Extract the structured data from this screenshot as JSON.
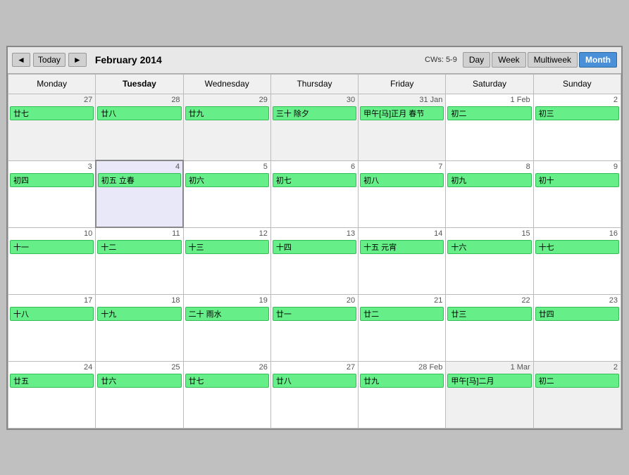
{
  "toolbar": {
    "prev_label": "◄",
    "today_label": "Today",
    "next_label": "►",
    "title": "February 2014",
    "cws_label": "CWs: 5-9",
    "views": [
      "Day",
      "Week",
      "Multiweek",
      "Month"
    ],
    "active_view": "Month"
  },
  "columns": [
    "Monday",
    "Tuesday",
    "Wednesday",
    "Thursday",
    "Friday",
    "Saturday",
    "Sunday"
  ],
  "today_col_index": 1,
  "weeks": [
    {
      "cells": [
        {
          "date": "27",
          "date_label": "27",
          "other_month": true,
          "event": "廿七"
        },
        {
          "date": "28",
          "date_label": "28",
          "other_month": true,
          "event": "廿八"
        },
        {
          "date": "29",
          "date_label": "29",
          "other_month": true,
          "event": "廿九"
        },
        {
          "date": "30",
          "date_label": "30",
          "other_month": true,
          "event": "三十 除夕"
        },
        {
          "date": "31 Jan",
          "date_label": "31 Jan",
          "other_month": true,
          "event": "甲午[马]正月 春节"
        },
        {
          "date": "1 Feb",
          "date_label": "1 Feb",
          "other_month": false,
          "event": "初二"
        },
        {
          "date": "2",
          "date_label": "2",
          "other_month": false,
          "event": "初三"
        }
      ]
    },
    {
      "cells": [
        {
          "date": "3",
          "date_label": "3",
          "other_month": false,
          "event": "初四"
        },
        {
          "date": "4",
          "date_label": "4",
          "other_month": false,
          "today": true,
          "event": "初五 立春"
        },
        {
          "date": "5",
          "date_label": "5",
          "other_month": false,
          "event": "初六"
        },
        {
          "date": "6",
          "date_label": "6",
          "other_month": false,
          "event": "初七"
        },
        {
          "date": "7",
          "date_label": "7",
          "other_month": false,
          "event": "初八"
        },
        {
          "date": "8",
          "date_label": "8",
          "other_month": false,
          "event": "初九"
        },
        {
          "date": "9",
          "date_label": "9",
          "other_month": false,
          "event": "初十"
        }
      ]
    },
    {
      "cells": [
        {
          "date": "10",
          "date_label": "10",
          "other_month": false,
          "event": "十一"
        },
        {
          "date": "11",
          "date_label": "11",
          "other_month": false,
          "event": "十二"
        },
        {
          "date": "12",
          "date_label": "12",
          "other_month": false,
          "event": "十三"
        },
        {
          "date": "13",
          "date_label": "13",
          "other_month": false,
          "event": "十四"
        },
        {
          "date": "14",
          "date_label": "14",
          "other_month": false,
          "event": "十五 元宵"
        },
        {
          "date": "15",
          "date_label": "15",
          "other_month": false,
          "event": "十六"
        },
        {
          "date": "16",
          "date_label": "16",
          "other_month": false,
          "event": "十七"
        }
      ]
    },
    {
      "cells": [
        {
          "date": "17",
          "date_label": "17",
          "other_month": false,
          "event": "十八"
        },
        {
          "date": "18",
          "date_label": "18",
          "other_month": false,
          "event": "十九"
        },
        {
          "date": "19",
          "date_label": "19",
          "other_month": false,
          "event": "二十 雨水"
        },
        {
          "date": "20",
          "date_label": "20",
          "other_month": false,
          "event": "廿一"
        },
        {
          "date": "21",
          "date_label": "21",
          "other_month": false,
          "event": "廿二"
        },
        {
          "date": "22",
          "date_label": "22",
          "other_month": false,
          "event": "廿三"
        },
        {
          "date": "23",
          "date_label": "23",
          "other_month": false,
          "event": "廿四"
        }
      ]
    },
    {
      "cells": [
        {
          "date": "24",
          "date_label": "24",
          "other_month": false,
          "event": "廿五"
        },
        {
          "date": "25",
          "date_label": "25",
          "other_month": false,
          "event": "廿六"
        },
        {
          "date": "26",
          "date_label": "26",
          "other_month": false,
          "event": "廿七"
        },
        {
          "date": "27",
          "date_label": "27",
          "other_month": false,
          "event": "廿八"
        },
        {
          "date": "28 Feb",
          "date_label": "28 Feb",
          "other_month": false,
          "event": "廿九"
        },
        {
          "date": "1 Mar",
          "date_label": "1 Mar",
          "other_month": true,
          "event": "甲午[马]二月"
        },
        {
          "date": "2",
          "date_label": "2",
          "other_month": true,
          "event": "初二"
        }
      ]
    }
  ]
}
